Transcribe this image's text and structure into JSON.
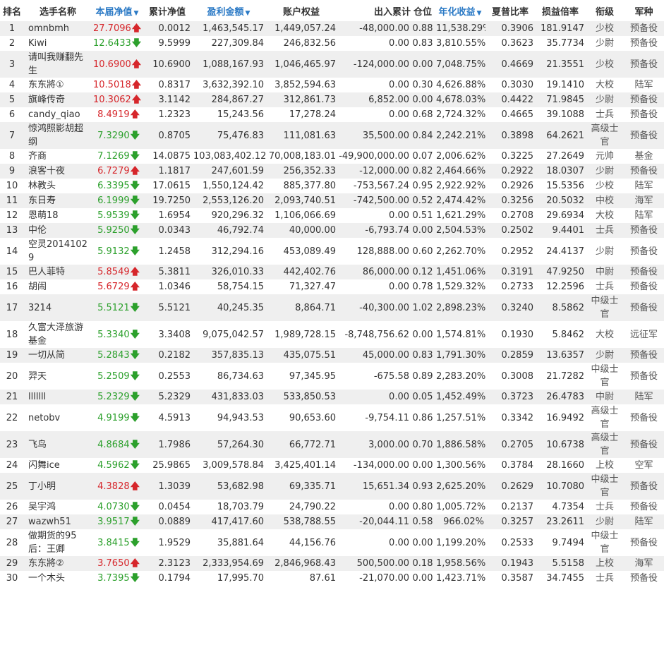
{
  "table": {
    "headers": {
      "rank": "排名",
      "name": "选手名称",
      "current_nav": "本届净值",
      "cum_nav": "累计净值",
      "profit": "盈利金额",
      "equity": "账户权益",
      "inout": "出入累计",
      "position": "仓位",
      "annual": "年化收益",
      "sharpe": "夏普比率",
      "plr": "损益倍率",
      "title": "衔级",
      "army": "军种"
    },
    "sort_icon": "▼",
    "up_arrow": "🡅",
    "down_arrow": "🡇",
    "colors": {
      "up": "#d6262b",
      "down": "#2ca02c",
      "header_accent": "#2a79c5"
    },
    "rows": [
      {
        "rank": "1",
        "name": "omnbmh",
        "nav": "27.7096",
        "dir": "up",
        "cum": "0.0012",
        "profit": "1,463,545.17",
        "equity": "1,449,057.24",
        "inout": "-48,000.00",
        "pos": "0.88",
        "annual": "11,538.29%",
        "sharpe": "0.3906",
        "plr": "181.9147",
        "title": "少校",
        "army": "预备役",
        "tall": false
      },
      {
        "rank": "2",
        "name": "Kiwi",
        "nav": "12.6433",
        "dir": "down",
        "cum": "9.5999",
        "profit": "227,309.84",
        "equity": "246,832.56",
        "inout": "0.00",
        "pos": "0.83",
        "annual": "3,810.55%",
        "sharpe": "0.3623",
        "plr": "35.7734",
        "title": "少尉",
        "army": "预备役",
        "tall": false
      },
      {
        "rank": "3",
        "name": "请叫我赚翻先生",
        "nav": "10.6900",
        "dir": "up",
        "cum": "10.6900",
        "profit": "1,088,167.93",
        "equity": "1,046,465.97",
        "inout": "-124,000.00",
        "pos": "0.00",
        "annual": "7,048.75%",
        "sharpe": "0.4669",
        "plr": "21.3551",
        "title": "少校",
        "army": "预备役",
        "tall": true
      },
      {
        "rank": "4",
        "name": "东东將①",
        "nav": "10.5018",
        "dir": "up",
        "cum": "0.8317",
        "profit": "3,632,392.10",
        "equity": "3,852,594.63",
        "inout": "0.00",
        "pos": "0.30",
        "annual": "4,626.88%",
        "sharpe": "0.3030",
        "plr": "19.1410",
        "title": "大校",
        "army": "陆军",
        "tall": false
      },
      {
        "rank": "5",
        "name": "旗峰传奇",
        "nav": "10.3062",
        "dir": "up",
        "cum": "3.1142",
        "profit": "284,867.27",
        "equity": "312,861.73",
        "inout": "6,852.00",
        "pos": "0.00",
        "annual": "4,678.03%",
        "sharpe": "0.4422",
        "plr": "71.9845",
        "title": "少尉",
        "army": "预备役",
        "tall": false
      },
      {
        "rank": "6",
        "name": "candy_qiao",
        "nav": "8.4919",
        "dir": "up",
        "cum": "1.2323",
        "profit": "15,243.56",
        "equity": "17,278.24",
        "inout": "0.00",
        "pos": "0.68",
        "annual": "2,724.32%",
        "sharpe": "0.4665",
        "plr": "39.1088",
        "title": "士兵",
        "army": "预备役",
        "tall": false
      },
      {
        "rank": "7",
        "name": "惊鸿照影胡超纲",
        "nav": "7.3290",
        "dir": "down",
        "cum": "0.8705",
        "profit": "75,476.83",
        "equity": "111,081.63",
        "inout": "35,500.00",
        "pos": "0.84",
        "annual": "2,242.21%",
        "sharpe": "0.3898",
        "plr": "64.2621",
        "title": "高级士官",
        "army": "预备役",
        "tall": true
      },
      {
        "rank": "8",
        "name": "齐商",
        "nav": "7.1269",
        "dir": "down",
        "cum": "14.0875",
        "profit": "103,083,402.12",
        "equity": "70,008,183.01",
        "inout": "-49,900,000.00",
        "pos": "0.07",
        "annual": "2,006.62%",
        "sharpe": "0.3225",
        "plr": "27.2649",
        "title": "元帅",
        "army": "基金",
        "tall": false
      },
      {
        "rank": "9",
        "name": "浪客十夜",
        "nav": "6.7279",
        "dir": "up",
        "cum": "1.1817",
        "profit": "247,601.59",
        "equity": "256,352.33",
        "inout": "-12,000.00",
        "pos": "0.82",
        "annual": "2,464.66%",
        "sharpe": "0.2922",
        "plr": "18.0307",
        "title": "少尉",
        "army": "预备役",
        "tall": false
      },
      {
        "rank": "10",
        "name": "林教头",
        "nav": "6.3395",
        "dir": "down",
        "cum": "17.0615",
        "profit": "1,550,124.42",
        "equity": "885,377.80",
        "inout": "-753,567.24",
        "pos": "0.95",
        "annual": "2,922.92%",
        "sharpe": "0.2926",
        "plr": "15.5356",
        "title": "少校",
        "army": "陆军",
        "tall": false
      },
      {
        "rank": "11",
        "name": "东日寿",
        "nav": "6.1999",
        "dir": "down",
        "cum": "19.7250",
        "profit": "2,553,126.20",
        "equity": "2,093,740.51",
        "inout": "-742,500.00",
        "pos": "0.52",
        "annual": "2,474.42%",
        "sharpe": "0.3256",
        "plr": "20.5032",
        "title": "中校",
        "army": "海军",
        "tall": false
      },
      {
        "rank": "12",
        "name": "恩萌18",
        "nav": "5.9539",
        "dir": "down",
        "cum": "1.6954",
        "profit": "920,296.32",
        "equity": "1,106,066.69",
        "inout": "0.00",
        "pos": "0.51",
        "annual": "1,621.29%",
        "sharpe": "0.2708",
        "plr": "29.6934",
        "title": "大校",
        "army": "陆军",
        "tall": false
      },
      {
        "rank": "13",
        "name": "中伦",
        "nav": "5.9250",
        "dir": "down",
        "cum": "0.0343",
        "profit": "46,792.74",
        "equity": "40,000.00",
        "inout": "-6,793.74",
        "pos": "0.00",
        "annual": "2,504.53%",
        "sharpe": "0.2502",
        "plr": "9.4401",
        "title": "士兵",
        "army": "预备役",
        "tall": false
      },
      {
        "rank": "14",
        "name": "空灵20141029",
        "nav": "5.9132",
        "dir": "down",
        "cum": "1.2458",
        "profit": "312,294.16",
        "equity": "453,089.49",
        "inout": "128,888.00",
        "pos": "0.60",
        "annual": "2,262.70%",
        "sharpe": "0.2952",
        "plr": "24.4137",
        "title": "少尉",
        "army": "预备役",
        "tall": true
      },
      {
        "rank": "15",
        "name": "巴人菲特",
        "nav": "5.8549",
        "dir": "up",
        "cum": "5.3811",
        "profit": "326,010.33",
        "equity": "442,402.76",
        "inout": "86,000.00",
        "pos": "0.12",
        "annual": "1,451.06%",
        "sharpe": "0.3191",
        "plr": "47.9250",
        "title": "中尉",
        "army": "预备役",
        "tall": false
      },
      {
        "rank": "16",
        "name": "胡闹",
        "nav": "5.6729",
        "dir": "up",
        "cum": "1.0346",
        "profit": "58,754.15",
        "equity": "71,327.47",
        "inout": "0.00",
        "pos": "0.78",
        "annual": "1,529.32%",
        "sharpe": "0.2733",
        "plr": "12.2596",
        "title": "士兵",
        "army": "预备役",
        "tall": false
      },
      {
        "rank": "17",
        "name": "3214",
        "nav": "5.5121",
        "dir": "down",
        "cum": "5.5121",
        "profit": "40,245.35",
        "equity": "8,864.71",
        "inout": "-40,300.00",
        "pos": "1.02",
        "annual": "2,898.23%",
        "sharpe": "0.3240",
        "plr": "8.5862",
        "title": "中级士官",
        "army": "预备役",
        "tall": true
      },
      {
        "rank": "18",
        "name": "久富大泽旅游基金",
        "nav": "5.3340",
        "dir": "down",
        "cum": "3.3408",
        "profit": "9,075,042.57",
        "equity": "1,989,728.15",
        "inout": "-8,748,756.62",
        "pos": "0.00",
        "annual": "1,574.81%",
        "sharpe": "0.1930",
        "plr": "5.8462",
        "title": "大校",
        "army": "远征军",
        "tall": true
      },
      {
        "rank": "19",
        "name": "一切从简",
        "nav": "5.2843",
        "dir": "down",
        "cum": "0.2182",
        "profit": "357,835.13",
        "equity": "435,075.51",
        "inout": "45,000.00",
        "pos": "0.83",
        "annual": "1,791.30%",
        "sharpe": "0.2859",
        "plr": "13.6357",
        "title": "少尉",
        "army": "预备役",
        "tall": false
      },
      {
        "rank": "20",
        "name": "羿天",
        "nav": "5.2509",
        "dir": "down",
        "cum": "0.2553",
        "profit": "86,734.63",
        "equity": "97,345.95",
        "inout": "-675.58",
        "pos": "0.89",
        "annual": "2,283.20%",
        "sharpe": "0.3008",
        "plr": "21.7282",
        "title": "中级士官",
        "army": "预备役",
        "tall": true
      },
      {
        "rank": "21",
        "name": "lllllll",
        "nav": "5.2329",
        "dir": "down",
        "cum": "5.2329",
        "profit": "431,833.03",
        "equity": "533,850.53",
        "inout": "0.00",
        "pos": "0.05",
        "annual": "1,452.49%",
        "sharpe": "0.3723",
        "plr": "26.4783",
        "title": "中尉",
        "army": "陆军",
        "tall": false
      },
      {
        "rank": "22",
        "name": "netobv",
        "nav": "4.9199",
        "dir": "down",
        "cum": "4.5913",
        "profit": "94,943.53",
        "equity": "90,653.60",
        "inout": "-9,754.11",
        "pos": "0.86",
        "annual": "1,257.51%",
        "sharpe": "0.3342",
        "plr": "16.9492",
        "title": "高级士官",
        "army": "预备役",
        "tall": true
      },
      {
        "rank": "23",
        "name": "飞鸟",
        "nav": "4.8684",
        "dir": "down",
        "cum": "1.7986",
        "profit": "57,264.30",
        "equity": "66,772.71",
        "inout": "3,000.00",
        "pos": "0.70",
        "annual": "1,886.58%",
        "sharpe": "0.2705",
        "plr": "10.6738",
        "title": "高级士官",
        "army": "预备役",
        "tall": true
      },
      {
        "rank": "24",
        "name": "闪舞ice",
        "nav": "4.5962",
        "dir": "down",
        "cum": "25.9865",
        "profit": "3,009,578.84",
        "equity": "3,425,401.14",
        "inout": "-134,000.00",
        "pos": "0.00",
        "annual": "1,300.56%",
        "sharpe": "0.3784",
        "plr": "28.1660",
        "title": "上校",
        "army": "空军",
        "tall": false
      },
      {
        "rank": "25",
        "name": "丁小明",
        "nav": "4.3828",
        "dir": "up",
        "cum": "1.3039",
        "profit": "53,682.98",
        "equity": "69,335.71",
        "inout": "15,651.34",
        "pos": "0.93",
        "annual": "2,625.20%",
        "sharpe": "0.2629",
        "plr": "10.7080",
        "title": "中级士官",
        "army": "预备役",
        "tall": true
      },
      {
        "rank": "26",
        "name": "吴宇鸿",
        "nav": "4.0730",
        "dir": "down",
        "cum": "0.0454",
        "profit": "18,703.79",
        "equity": "24,790.22",
        "inout": "0.00",
        "pos": "0.80",
        "annual": "1,005.72%",
        "sharpe": "0.2137",
        "plr": "4.7354",
        "title": "士兵",
        "army": "预备役",
        "tall": false
      },
      {
        "rank": "27",
        "name": "wazwh51",
        "nav": "3.9517",
        "dir": "down",
        "cum": "0.0889",
        "profit": "417,417.60",
        "equity": "538,788.55",
        "inout": "-20,044.11",
        "pos": "0.58",
        "annual": "966.02%",
        "sharpe": "0.3257",
        "plr": "23.2611",
        "title": "少尉",
        "army": "陆军",
        "tall": false
      },
      {
        "rank": "28",
        "name": "做期货的95后：王卿",
        "nav": "3.8415",
        "dir": "down",
        "cum": "1.9529",
        "profit": "35,881.64",
        "equity": "44,156.76",
        "inout": "0.00",
        "pos": "0.00",
        "annual": "1,199.20%",
        "sharpe": "0.2533",
        "plr": "9.7494",
        "title": "中级士官",
        "army": "预备役",
        "tall": true
      },
      {
        "rank": "29",
        "name": "东东將②",
        "nav": "3.7650",
        "dir": "up",
        "cum": "2.3123",
        "profit": "2,333,954.69",
        "equity": "2,846,968.43",
        "inout": "500,500.00",
        "pos": "0.18",
        "annual": "1,958.56%",
        "sharpe": "0.1943",
        "plr": "5.5158",
        "title": "上校",
        "army": "海军",
        "tall": false
      },
      {
        "rank": "30",
        "name": "一个木头",
        "nav": "3.7395",
        "dir": "down",
        "cum": "0.1794",
        "profit": "17,995.70",
        "equity": "87.61",
        "inout": "-21,070.00",
        "pos": "0.00",
        "annual": "1,423.71%",
        "sharpe": "0.3587",
        "plr": "34.7455",
        "title": "士兵",
        "army": "预备役",
        "tall": false
      }
    ]
  }
}
